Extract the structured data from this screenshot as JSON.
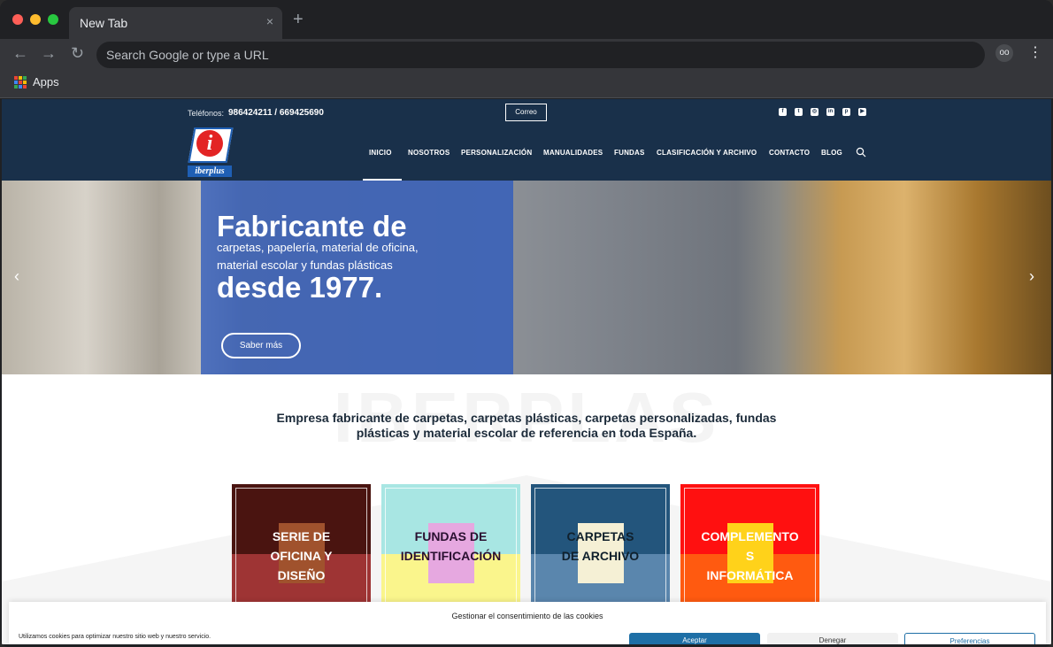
{
  "browser": {
    "tab": {
      "title": "New Tab",
      "close_glyph": "×"
    },
    "new_tab_glyph": "+",
    "nav": {
      "back": "←",
      "forward": "→",
      "reload": "↻"
    },
    "omnibox_placeholder": "Search Google or type a URL",
    "menu_glyph": "⋮",
    "bookmarks": {
      "apps_label": "Apps"
    },
    "colors": {
      "frame": "#202124",
      "toolbar": "#35363a"
    }
  },
  "site": {
    "topbar": {
      "phones_label": "Teléfonos:",
      "phones_value": "986424211 / 669425690",
      "mail_button": "Correo",
      "social_icons": [
        "facebook-icon",
        "twitter-icon",
        "instagram-icon",
        "linkedin-icon",
        "pinterest-icon",
        "youtube-icon"
      ]
    },
    "logo": {
      "letter": "i",
      "wordmark": "iberplus"
    },
    "nav": {
      "items": [
        "INICIO",
        "NOSOTROS",
        "PERSONALIZACIÓN",
        "MANUALIDADES",
        "FUNDAS",
        "CLASIFICACIÓN Y ARCHIVO",
        "CONTACTO",
        "BLOG"
      ],
      "active": "INICIO"
    },
    "hero": {
      "heading": "Fabricante de",
      "subline_1": "carpetas, papelería, material de oficina,",
      "subline_2": "material escolar y fundas plásticas",
      "heading_2": "desde 1977.",
      "button": "Saber más",
      "prev_glyph": "‹",
      "next_glyph": "›"
    },
    "watermark": "IBERPLAS",
    "intro": "Empresa fabricante de carpetas, carpetas plásticas, carpetas personalizadas, fundas plásticas y material escolar de referencia en toda España.",
    "categories": [
      {
        "label_lines": [
          "SERIE DE",
          "OFICINA Y",
          "DISEÑO"
        ],
        "top": "#4a1410",
        "bottom": "#9e3434",
        "block": "#a0522d",
        "text_color": "#ffffff"
      },
      {
        "label_lines": [
          "",
          "FUNDAS DE",
          "IDENTIFICACIÓN"
        ],
        "top": "#a8e6e3",
        "bottom": "#faf58c",
        "block": "#e6a8e0",
        "text_color": "#2a1030"
      },
      {
        "label_lines": [
          "",
          "CARPETAS",
          "DE ARCHIVO"
        ],
        "top": "#23557c",
        "bottom": "#5a86ad",
        "block": "#f5f0d5",
        "text_color": "#10202c"
      },
      {
        "label_lines": [
          "COMPLEMENTO",
          "S",
          "INFORMÁTICA"
        ],
        "top": "#ff1010",
        "bottom": "#ff5a10",
        "block": "#ffd21a",
        "text_color": "#ffffff"
      }
    ],
    "cookie_banner": {
      "title": "Gestionar el consentimiento de las cookies",
      "text": "Utilizamos cookies para optimizar nuestro sitio web y nuestro servicio.",
      "accept": "Aceptar",
      "deny": "Denegar",
      "preferences": "Preferencias"
    },
    "colors": {
      "header": "#19304a",
      "hero_overlay": "#2d5abe",
      "cookie_accent": "#1e6fa6"
    }
  }
}
